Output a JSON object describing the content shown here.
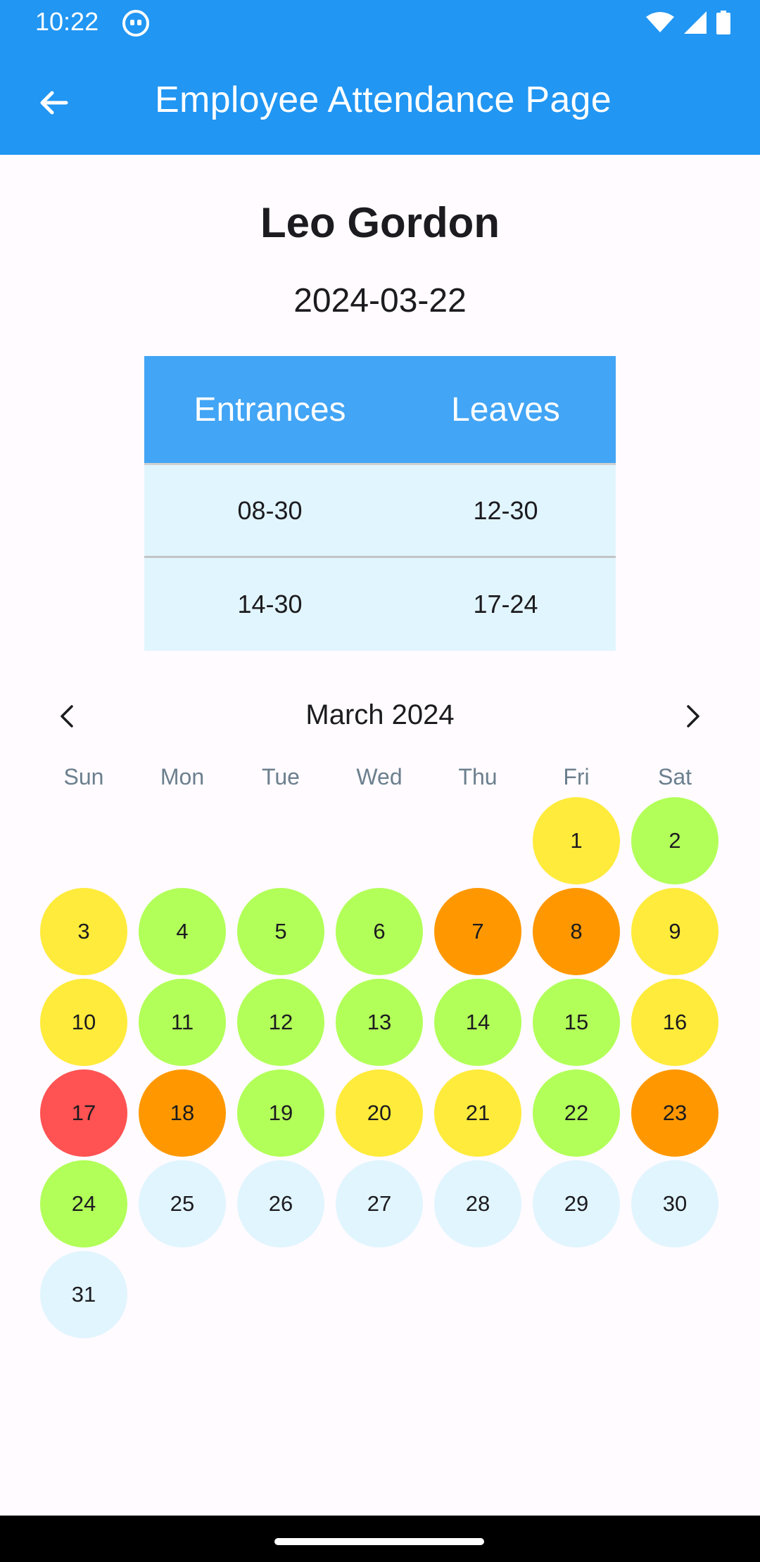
{
  "status_bar": {
    "time": "10:22"
  },
  "app_bar": {
    "title": "Employee Attendance Page"
  },
  "employee": {
    "name": "Leo Gordon",
    "date": "2024-03-22"
  },
  "attendance_table": {
    "headers": [
      "Entrances",
      "Leaves"
    ],
    "rows": [
      [
        "08-30",
        "12-30"
      ],
      [
        "14-30",
        "17-24"
      ]
    ]
  },
  "calendar": {
    "month_label": "March 2024",
    "weekdays": [
      "Sun",
      "Mon",
      "Tue",
      "Wed",
      "Thu",
      "Fri",
      "Sat"
    ],
    "first_weekday_index": 5,
    "status_colors": {
      "yellow": "#ffeb3b",
      "green": "#b2ff59",
      "orange": "#ff9800",
      "red": "#ff5252",
      "none": "#e1f5fe"
    },
    "days": [
      {
        "day": "1",
        "status": "yellow"
      },
      {
        "day": "2",
        "status": "green"
      },
      {
        "day": "3",
        "status": "yellow"
      },
      {
        "day": "4",
        "status": "green"
      },
      {
        "day": "5",
        "status": "green"
      },
      {
        "day": "6",
        "status": "green"
      },
      {
        "day": "7",
        "status": "orange"
      },
      {
        "day": "8",
        "status": "orange"
      },
      {
        "day": "9",
        "status": "yellow"
      },
      {
        "day": "10",
        "status": "yellow"
      },
      {
        "day": "11",
        "status": "green"
      },
      {
        "day": "12",
        "status": "green"
      },
      {
        "day": "13",
        "status": "green"
      },
      {
        "day": "14",
        "status": "green"
      },
      {
        "day": "15",
        "status": "green"
      },
      {
        "day": "16",
        "status": "yellow"
      },
      {
        "day": "17",
        "status": "red"
      },
      {
        "day": "18",
        "status": "orange"
      },
      {
        "day": "19",
        "status": "green"
      },
      {
        "day": "20",
        "status": "yellow"
      },
      {
        "day": "21",
        "status": "yellow"
      },
      {
        "day": "22",
        "status": "green"
      },
      {
        "day": "23",
        "status": "orange"
      },
      {
        "day": "24",
        "status": "green"
      },
      {
        "day": "25",
        "status": "none"
      },
      {
        "day": "26",
        "status": "none"
      },
      {
        "day": "27",
        "status": "none"
      },
      {
        "day": "28",
        "status": "none"
      },
      {
        "day": "29",
        "status": "none"
      },
      {
        "day": "30",
        "status": "none"
      },
      {
        "day": "31",
        "status": "none"
      }
    ]
  },
  "icons": {
    "back": "arrow-left-icon",
    "prev_month": "chevron-left-icon",
    "next_month": "chevron-right-icon",
    "wifi": "wifi-icon",
    "signal": "cell-signal-icon",
    "battery": "battery-icon"
  },
  "colors": {
    "primary": "#2196f3",
    "table_header": "#42a5f5",
    "table_row": "#e1f5fe"
  }
}
